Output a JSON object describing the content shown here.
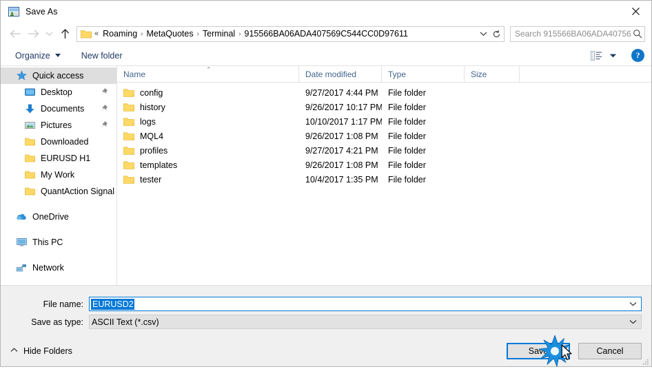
{
  "window": {
    "title": "Save As",
    "icon": "app-icon",
    "close_label": "✕"
  },
  "address": {
    "back_icon": "back-arrow-icon",
    "forward_icon": "forward-arrow-icon",
    "recent_icon": "chevron-down-icon",
    "up_icon": "up-arrow-icon",
    "folder_icon": "folder-icon",
    "lead_separator": "«",
    "separator": "›",
    "crumbs": [
      "Roaming",
      "MetaQuotes",
      "Terminal",
      "915566BA06ADA407569C544CC0D97611"
    ],
    "dropdown_icon": "chevron-down-icon",
    "refresh_icon": "refresh-icon"
  },
  "search": {
    "placeholder": "Search 915566BA06ADA40756...",
    "icon": "search-icon"
  },
  "toolbar": {
    "organize_label": "Organize",
    "new_folder_label": "New folder",
    "view_icon": "view-layout-icon",
    "view_caret_icon": "chevron-down-icon",
    "help_label": "?"
  },
  "sidebar": {
    "items": [
      {
        "label": "Quick access",
        "icon": "star-icon",
        "level": "root",
        "selected": true,
        "pinned": false
      },
      {
        "label": "Desktop",
        "icon": "desktop-icon",
        "level": "child",
        "selected": false,
        "pinned": true
      },
      {
        "label": "Documents",
        "icon": "documents-icon",
        "level": "child",
        "selected": false,
        "pinned": true
      },
      {
        "label": "Pictures",
        "icon": "pictures-icon",
        "level": "child",
        "selected": false,
        "pinned": true
      },
      {
        "label": "Downloaded",
        "icon": "folder-icon",
        "level": "child",
        "selected": false,
        "pinned": false
      },
      {
        "label": "EURUSD H1",
        "icon": "folder-icon",
        "level": "child",
        "selected": false,
        "pinned": false
      },
      {
        "label": "My Work",
        "icon": "folder-icon",
        "level": "child",
        "selected": false,
        "pinned": false
      },
      {
        "label": "QuantAction Signal",
        "icon": "folder-icon",
        "level": "child",
        "selected": false,
        "pinned": false
      },
      {
        "label": "OneDrive",
        "icon": "onedrive-icon",
        "level": "root",
        "selected": false,
        "pinned": false,
        "gap_before": true
      },
      {
        "label": "This PC",
        "icon": "computer-icon",
        "level": "root",
        "selected": false,
        "pinned": false,
        "gap_before": true
      },
      {
        "label": "Network",
        "icon": "network-icon",
        "level": "root",
        "selected": false,
        "pinned": false,
        "gap_before": true
      }
    ]
  },
  "filelist": {
    "columns": [
      "Name",
      "Date modified",
      "Type",
      "Size"
    ],
    "sort_indicator": "⌃",
    "rows": [
      {
        "name": "config",
        "date": "9/27/2017 4:44 PM",
        "type": "File folder",
        "size": ""
      },
      {
        "name": "history",
        "date": "9/26/2017 10:17 PM",
        "type": "File folder",
        "size": ""
      },
      {
        "name": "logs",
        "date": "10/10/2017 1:17 PM",
        "type": "File folder",
        "size": ""
      },
      {
        "name": "MQL4",
        "date": "9/26/2017 1:08 PM",
        "type": "File folder",
        "size": ""
      },
      {
        "name": "profiles",
        "date": "9/27/2017 4:21 PM",
        "type": "File folder",
        "size": ""
      },
      {
        "name": "templates",
        "date": "9/26/2017 1:08 PM",
        "type": "File folder",
        "size": ""
      },
      {
        "name": "tester",
        "date": "10/4/2017 1:35 PM",
        "type": "File folder",
        "size": ""
      }
    ]
  },
  "form": {
    "filename_label": "File name:",
    "filename_value": "EURUSD2",
    "filetype_label": "Save as type:",
    "filetype_value": "ASCII Text (*.csv)",
    "dropdown_icon": "chevron-down-icon"
  },
  "actions": {
    "hide_folders_label": "Hide Folders",
    "hide_folders_icon": "chevron-up-icon",
    "save_label": "Save",
    "cancel_label": "Cancel",
    "resize_grip_icon": "resize-grip-icon",
    "click_effect_icon": "click-burst-icon",
    "cursor_icon": "mouse-pointer-icon"
  },
  "colors": {
    "accent": "#0078d7",
    "folder_yellow": "#ffd966",
    "header_text": "#42658f",
    "command_text": "#1f3864"
  }
}
